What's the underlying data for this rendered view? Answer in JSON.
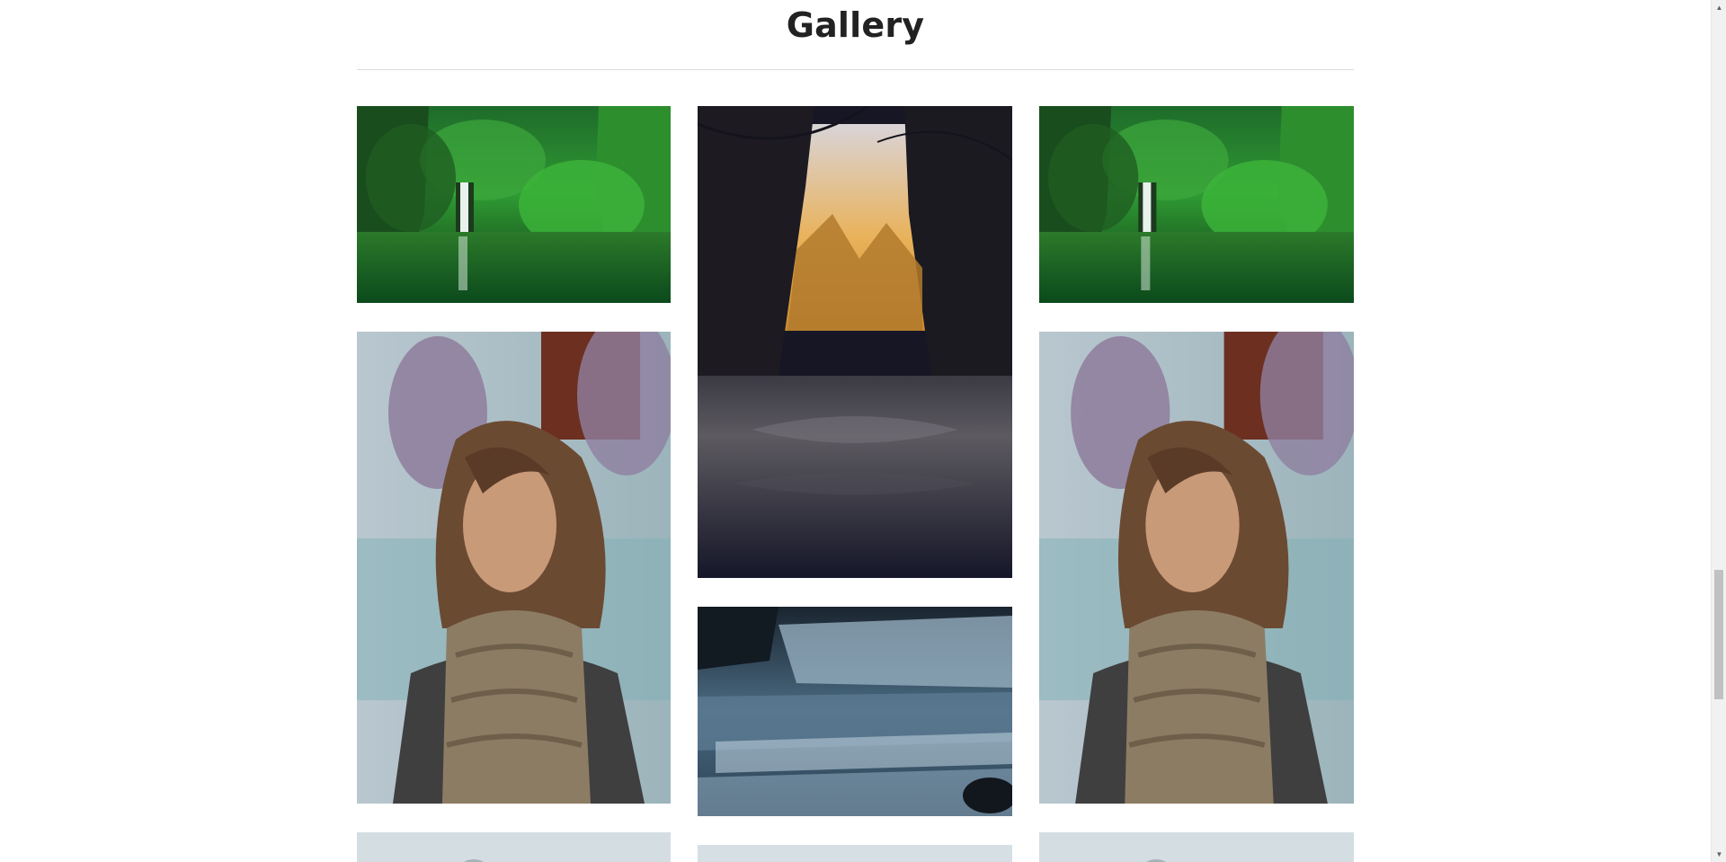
{
  "section": {
    "title": "Gallery"
  },
  "gallery": {
    "images": [
      {
        "subject": "green-gorge-waterfall"
      },
      {
        "subject": "forest-river-sunset"
      },
      {
        "subject": "green-gorge-waterfall"
      },
      {
        "subject": "woman-with-scarf-portrait"
      },
      {
        "subject": "blue-cascade-waterfall"
      },
      {
        "subject": "woman-with-scarf-portrait"
      }
    ]
  },
  "scrollbar": {
    "up_arrow": "▲",
    "down_arrow": "▼"
  }
}
